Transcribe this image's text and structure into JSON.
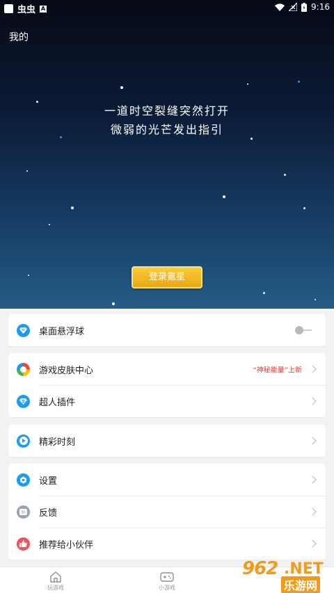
{
  "status_bar": {
    "app_badge": "虫虫",
    "a_badge": "A",
    "time": "9:16",
    "icons": [
      "wifi-icon",
      "signal-off-icon",
      "battery-icon"
    ]
  },
  "header": {
    "title": "我的"
  },
  "hero": {
    "tagline_line1": "一道时空裂缝突然打开",
    "tagline_line2": "微弱的光芒发出指引",
    "login_label": "登录氪星"
  },
  "colors": {
    "accent_blue": "#1e9bf0",
    "login_gold": "#f2b21f",
    "badge_red": "#e43a2f"
  },
  "cards": {
    "floating": {
      "label": "桌面悬浮球",
      "icon": "wifi-diamond-icon",
      "toggle_on": false
    },
    "skin": {
      "label": "游戏皮肤中心",
      "icon": "palette-icon",
      "badge": "“神秘能量”上新"
    },
    "plugin": {
      "label": "超人插件",
      "icon": "superman-icon"
    },
    "highlights": {
      "label": "精彩时刻",
      "icon": "play-icon"
    },
    "settings": {
      "label": "设置",
      "icon": "settings-icon"
    },
    "feedback": {
      "label": "反馈",
      "icon": "message-icon"
    },
    "recommend": {
      "label": "推荐给小伙伴",
      "icon": "thumb-up-icon"
    }
  },
  "bottom_nav": {
    "items": [
      {
        "label": "玩游戏",
        "icon": "home-icon"
      },
      {
        "label": "小游戏",
        "icon": "gamepad-icon"
      }
    ]
  },
  "watermark": {
    "number": "962",
    "net": ".NET",
    "site": "乐游网"
  }
}
